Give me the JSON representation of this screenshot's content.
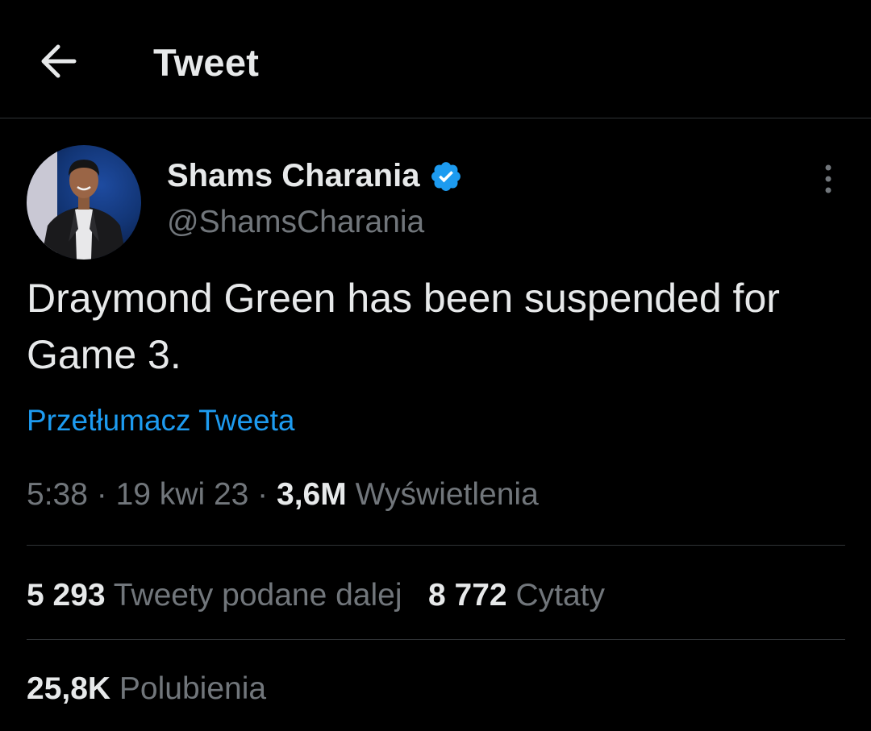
{
  "header": {
    "title": "Tweet",
    "back_icon": "arrow-left-icon"
  },
  "author": {
    "display_name": "Shams Charania",
    "handle": "@ShamsCharania",
    "verified": true,
    "verified_color": "#1d9bf0"
  },
  "tweet": {
    "text": "Draymond Green has been suspended for Game 3.",
    "translate_label": "Przetłumacz Tweeta",
    "time": "5:38",
    "separator": " · ",
    "date": "19 kwi 23",
    "views_count": "3,6M",
    "views_label": "Wyświetlenia"
  },
  "stats": {
    "retweets_count": "5 293",
    "retweets_label": "Tweety podane dalej",
    "quotes_count": "8 772",
    "quotes_label": "Cytaty",
    "likes_count": "25,8K",
    "likes_label": "Polubienia"
  },
  "colors": {
    "background": "#000000",
    "text": "#e7e9ea",
    "secondary": "#71767b",
    "accent": "#1d9bf0",
    "border": "#2f3336"
  }
}
